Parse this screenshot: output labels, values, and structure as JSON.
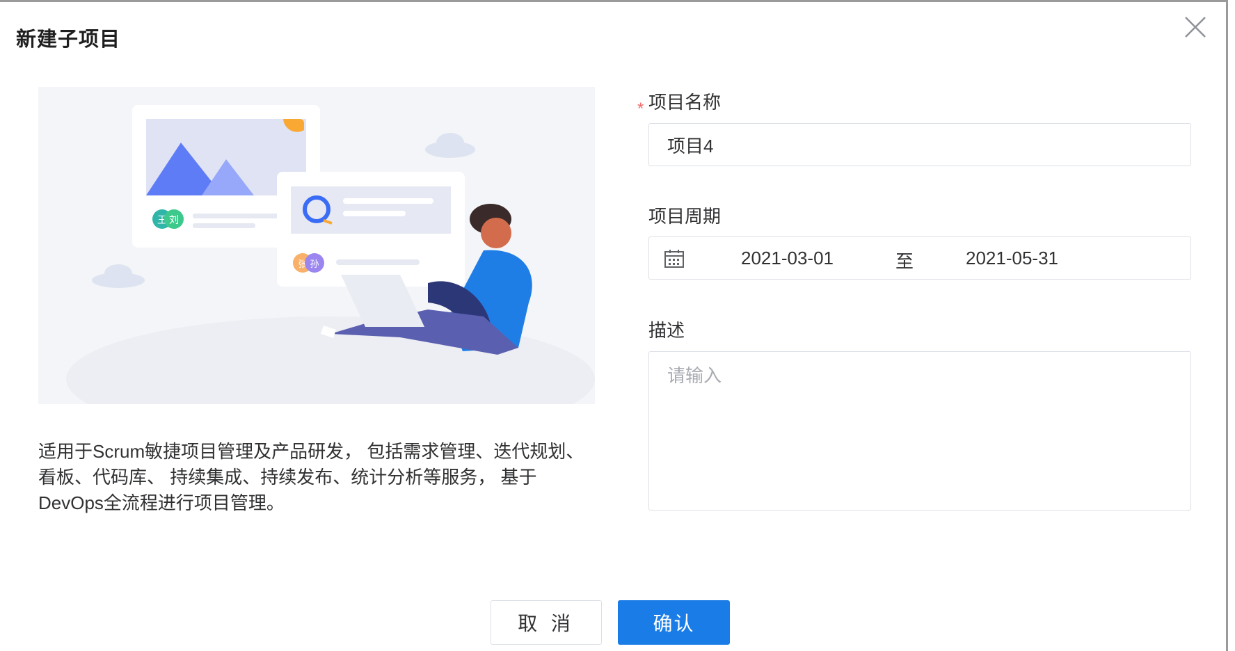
{
  "dialog": {
    "title": "新建子项目",
    "description": "适用于Scrum敏捷项目管理及产品研发， 包括需求管理、迭代规划、看板、代码库、 持续集成、持续发布、统计分析等服务， 基于DevOps全流程进行项目管理。"
  },
  "illustration": {
    "avatar_labels": [
      "王",
      "刘",
      "张",
      "孙"
    ]
  },
  "form": {
    "name": {
      "label": "项目名称",
      "required_mark": "*",
      "value": "项目4"
    },
    "period": {
      "label": "项目周期",
      "start": "2021-03-01",
      "separator": "至",
      "end": "2021-05-31"
    },
    "description": {
      "label": "描述",
      "placeholder": "请输入"
    }
  },
  "buttons": {
    "cancel": "取 消",
    "confirm": "确认"
  },
  "colors": {
    "primary": "#1a7ce6",
    "required": "#f56c6c",
    "border": "#dcdfe6"
  }
}
